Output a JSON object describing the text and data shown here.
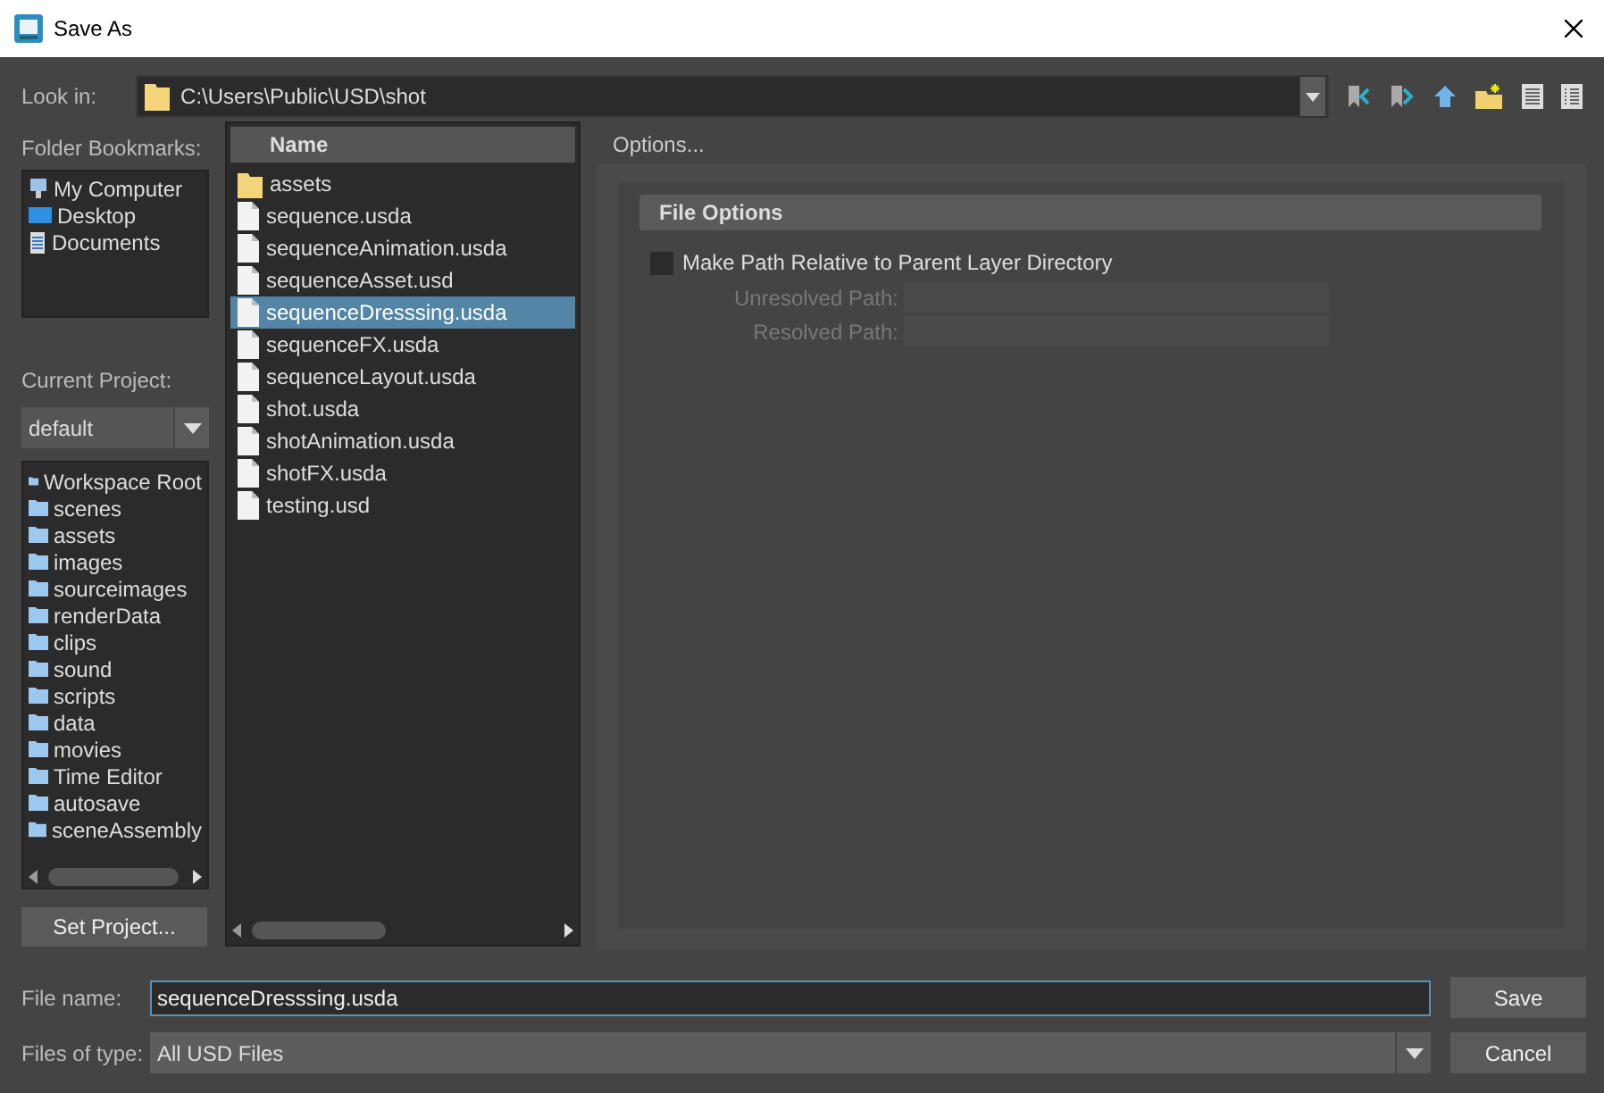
{
  "window": {
    "title": "Save As"
  },
  "look_in": {
    "label": "Look in:",
    "path": "C:\\Users\\Public\\USD\\shot"
  },
  "bookmarks": {
    "label": "Folder Bookmarks:",
    "items": [
      {
        "label": "My Computer",
        "kind": "computer"
      },
      {
        "label": "Desktop",
        "kind": "desktop"
      },
      {
        "label": "Documents",
        "kind": "documents"
      }
    ]
  },
  "current_project": {
    "label": "Current Project:",
    "value": "default"
  },
  "project_folders": [
    {
      "label": "Workspace Root"
    },
    {
      "label": "scenes"
    },
    {
      "label": "assets"
    },
    {
      "label": "images"
    },
    {
      "label": "sourceimages"
    },
    {
      "label": "renderData"
    },
    {
      "label": "clips"
    },
    {
      "label": "sound"
    },
    {
      "label": "scripts"
    },
    {
      "label": "data"
    },
    {
      "label": "movies"
    },
    {
      "label": "Time Editor"
    },
    {
      "label": "autosave"
    },
    {
      "label": "sceneAssembly"
    }
  ],
  "set_project_button": "Set Project...",
  "file_list": {
    "column": "Name",
    "items": [
      {
        "name": "assets",
        "kind": "folder",
        "selected": false
      },
      {
        "name": "sequence.usda",
        "kind": "file",
        "selected": false
      },
      {
        "name": "sequenceAnimation.usda",
        "kind": "file",
        "selected": false
      },
      {
        "name": "sequenceAsset.usd",
        "kind": "file",
        "selected": false
      },
      {
        "name": "sequenceDresssing.usda",
        "kind": "file",
        "selected": true
      },
      {
        "name": "sequenceFX.usda",
        "kind": "file",
        "selected": false
      },
      {
        "name": "sequenceLayout.usda",
        "kind": "file",
        "selected": false
      },
      {
        "name": "shot.usda",
        "kind": "file",
        "selected": false
      },
      {
        "name": "shotAnimation.usda",
        "kind": "file",
        "selected": false
      },
      {
        "name": "shotFX.usda",
        "kind": "file",
        "selected": false
      },
      {
        "name": "testing.usd",
        "kind": "file",
        "selected": false
      }
    ]
  },
  "options": {
    "title": "Options...",
    "section": "File Options",
    "checkbox": {
      "label": "Make Path Relative to Parent Layer Directory",
      "checked": false
    },
    "fields": [
      {
        "label": "Unresolved Path:"
      },
      {
        "label": "Resolved Path:"
      }
    ]
  },
  "file_name": {
    "label": "File name:",
    "value": "sequenceDresssing.usda"
  },
  "file_type": {
    "label": "Files of type:",
    "value": "All USD Files"
  },
  "buttons": [
    "Save",
    "Cancel"
  ]
}
